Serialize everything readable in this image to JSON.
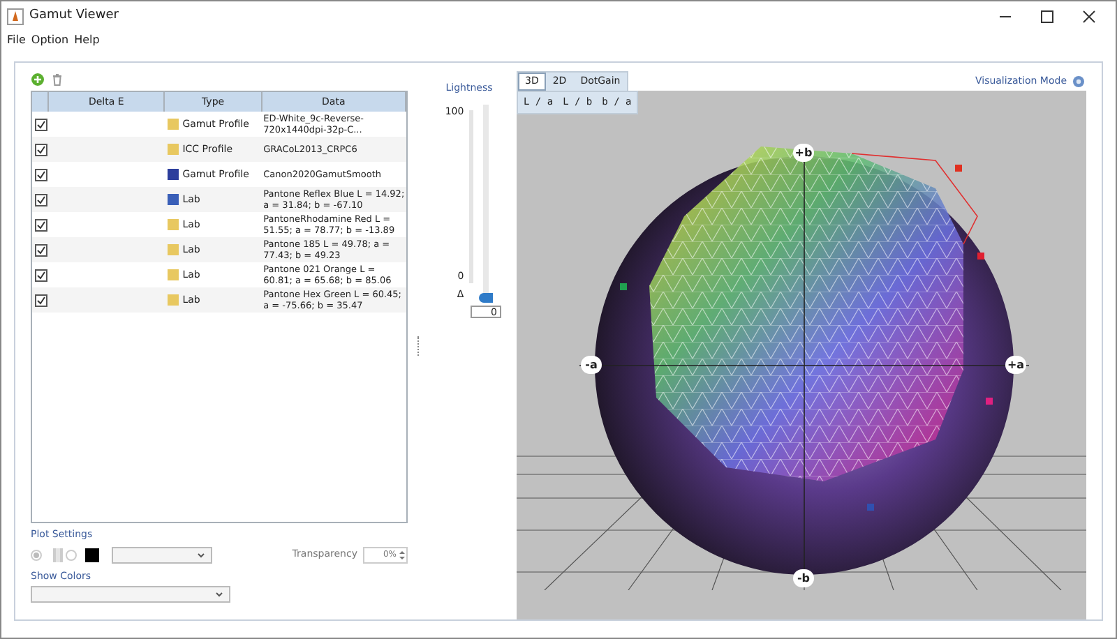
{
  "window": {
    "title": "Gamut Viewer"
  },
  "menu": [
    "File",
    "Option",
    "Help"
  ],
  "table": {
    "columns": [
      "Delta E",
      "Type",
      "Data"
    ],
    "rows": [
      {
        "checked": true,
        "color": "#e8c860",
        "type": "Gamut Profile",
        "data": "ED-White_9c-Reverse-720x1440dpi-32p-C..."
      },
      {
        "checked": true,
        "color": "#e8c860",
        "type": "ICC Profile",
        "data": "GRACoL2013_CRPC6"
      },
      {
        "checked": true,
        "color": "#2c3e9c",
        "type": "Gamut Profile",
        "data": "Canon2020GamutSmooth"
      },
      {
        "checked": true,
        "color": "#3a5fb8",
        "type": "Lab",
        "data": "Pantone Reflex Blue L = 14.92; a = 31.84; b = -67.10"
      },
      {
        "checked": true,
        "color": "#e8c860",
        "type": "Lab",
        "data": "PantoneRhodamine Red L = 51.55; a = 78.77; b = -13.89"
      },
      {
        "checked": true,
        "color": "#e8c860",
        "type": "Lab",
        "data": "Pantone 185 L = 49.78; a = 77.43; b = 49.23"
      },
      {
        "checked": true,
        "color": "#e8c860",
        "type": "Lab",
        "data": "Pantone 021 Orange L = 60.81; a = 65.68; b = 85.06"
      },
      {
        "checked": true,
        "color": "#e8c860",
        "type": "Lab",
        "data": "Pantone Hex Green L = 60.45; a = -75.66; b = 35.47"
      }
    ]
  },
  "plot_settings": {
    "label": "Plot Settings",
    "modes": [
      {
        "selected": true
      },
      {
        "selected": false
      }
    ],
    "transparency_label": "Transparency",
    "transparency": "0%"
  },
  "show_colors": {
    "label": "Show Colors"
  },
  "lightness": {
    "label": "Lightness",
    "max": "100",
    "min": "0",
    "delta": "Δ",
    "level": 0,
    "value": "0"
  },
  "view_tabs": [
    {
      "label": "3D",
      "selected": true
    },
    {
      "label": "2D",
      "selected": false
    },
    {
      "label": "DotGain",
      "selected": false
    }
  ],
  "plane_tabs": [
    {
      "label": "L / a",
      "selected": false
    },
    {
      "label": "L / b",
      "selected": false
    },
    {
      "label": "b / a",
      "selected": false
    }
  ],
  "visualization_mode": "Visualization Mode",
  "axes": {
    "top": "+b",
    "left": "-a",
    "right": "+a",
    "bottom": "-b"
  }
}
